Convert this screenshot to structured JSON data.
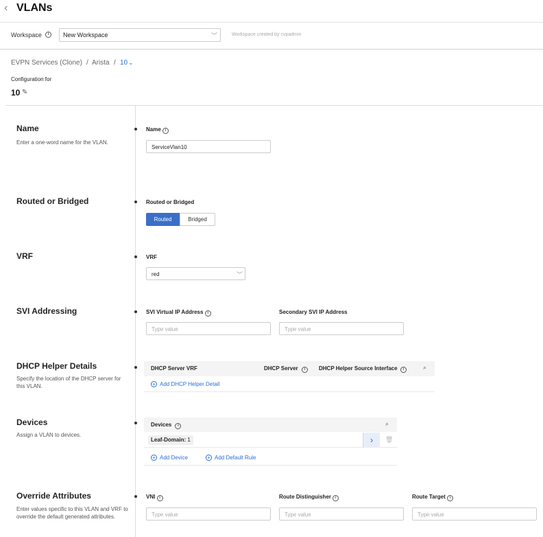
{
  "header": {
    "title": "VLANs"
  },
  "workspace": {
    "label": "Workspace",
    "selected": "New Workspace",
    "created_by": "Workspace created by cvpadmin"
  },
  "breadcrumb": {
    "items": [
      "EVPN Services (Clone)",
      "Arista",
      "10"
    ]
  },
  "config": {
    "label": "Configuration for",
    "value": "10"
  },
  "sections": {
    "name": {
      "title": "Name",
      "desc": "Enter a one-word name for the VLAN.",
      "field_label": "Name",
      "value": "ServiceVlan10"
    },
    "routed": {
      "title": "Routed or Bridged",
      "field_label": "Routed or Bridged",
      "options": [
        "Routed",
        "Bridged"
      ],
      "selected": "Routed"
    },
    "vrf": {
      "title": "VRF",
      "field_label": "VRF",
      "value": "red"
    },
    "svi": {
      "title": "SVI Addressing",
      "virtual_label": "SVI Virtual IP Address",
      "secondary_label": "Secondary SVI IP Address",
      "placeholder": "Type value"
    },
    "dhcp": {
      "title": "DHCP Helper Details",
      "desc": "Specify the location of the DHCP server for this VLAN.",
      "columns": [
        "DHCP Server VRF",
        "DHCP Server",
        "DHCP Helper Source Interface"
      ],
      "add_link": "Add DHCP Helper Detail"
    },
    "devices": {
      "title": "Devices",
      "desc": "Assign a VLAN to devices.",
      "column": "Devices",
      "row_label": "Leaf-Domain:",
      "row_count": "1",
      "add_device": "Add Device",
      "add_rule": "Add Default Rule"
    },
    "override": {
      "title": "Override Attributes",
      "desc": "Enter values specific to this VLAN and VRF to override the default generated attributes.",
      "vni_label": "VNI",
      "rd_label": "Route Distinguisher",
      "rt_label": "Route Target",
      "placeholder": "Type value"
    }
  },
  "colors": {
    "accent": "#3a6fc9",
    "link": "#2a6fd6"
  }
}
